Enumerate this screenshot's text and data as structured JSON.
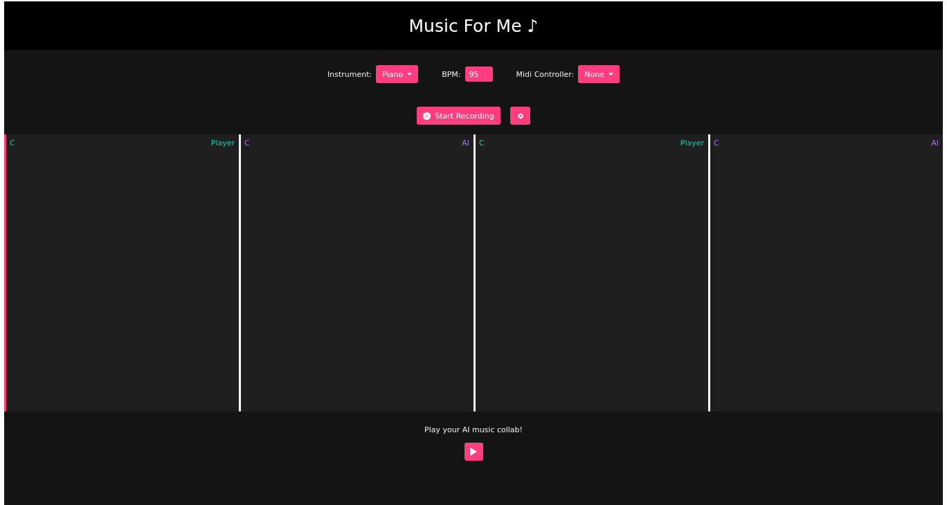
{
  "title": "Music For Me ♪",
  "controls": [
    {
      "kind": "dropdown",
      "label": "Instrument:",
      "value": "Piano"
    },
    {
      "kind": "input",
      "label": "BPM:",
      "value": "95"
    },
    {
      "kind": "dropdown",
      "label": "Midi Controller:",
      "value": "None"
    }
  ],
  "record_button": {
    "label": "Start Recording"
  },
  "lanes": [
    {
      "note": "C",
      "role": "Player",
      "kind": "player",
      "selected": true
    },
    {
      "note": "C",
      "role": "AI",
      "kind": "ai",
      "selected": false
    },
    {
      "note": "C",
      "role": "Player",
      "kind": "player",
      "selected": false
    },
    {
      "note": "C",
      "role": "AI",
      "kind": "ai",
      "selected": false
    }
  ],
  "footer": {
    "prompt": "Play your AI music collab!"
  }
}
